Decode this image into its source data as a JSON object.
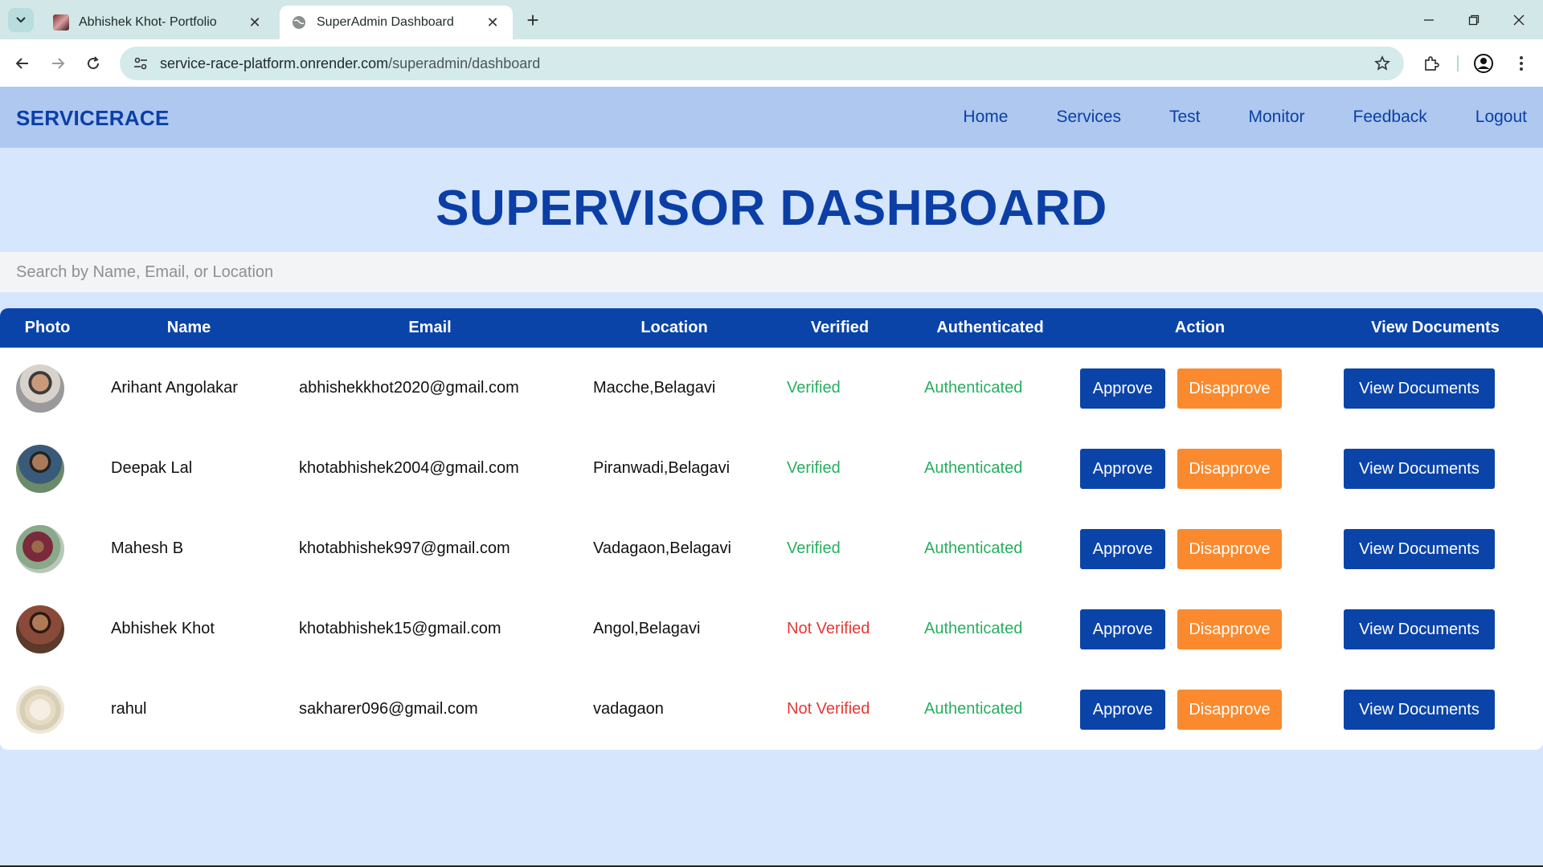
{
  "browser": {
    "tabs": [
      {
        "title": "Abhishek Khot- Portfolio",
        "active": false
      },
      {
        "title": "SuperAdmin Dashboard",
        "active": true
      }
    ],
    "url_host": "service-race-platform.onrender.com",
    "url_path": "/superadmin/dashboard"
  },
  "nav": {
    "brand": "SERVICERACE",
    "links": [
      "Home",
      "Services",
      "Test",
      "Monitor",
      "Feedback",
      "Logout"
    ]
  },
  "page": {
    "title": "SUPERVISOR DASHBOARD",
    "search_placeholder": "Search by Name, Email, or Location"
  },
  "table": {
    "headers": [
      "Photo",
      "Name",
      "Email",
      "Location",
      "Verified",
      "Authenticated",
      "Action",
      "View Documents"
    ],
    "buttons": {
      "approve": "Approve",
      "disapprove": "Disapprove",
      "view_documents": "View Documents"
    },
    "rows": [
      {
        "name": "Arihant Angolakar",
        "email": "abhishekkhot2020@gmail.com",
        "location": "Macche,Belagavi",
        "verified": "Verified",
        "authenticated": "Authenticated"
      },
      {
        "name": "Deepak Lal",
        "email": "khotabhishek2004@gmail.com",
        "location": "Piranwadi,Belagavi",
        "verified": "Verified",
        "authenticated": "Authenticated"
      },
      {
        "name": "Mahesh B",
        "email": "khotabhishek997@gmail.com",
        "location": "Vadagaon,Belagavi",
        "verified": "Verified",
        "authenticated": "Authenticated"
      },
      {
        "name": "Abhishek Khot",
        "email": "khotabhishek15@gmail.com",
        "location": "Angol,Belagavi",
        "verified": "Not Verified",
        "authenticated": "Authenticated"
      },
      {
        "name": "rahul",
        "email": "sakharer096@gmail.com",
        "location": "vadagaon",
        "verified": "Not Verified",
        "authenticated": "Authenticated"
      }
    ]
  },
  "colors": {
    "brand_blue": "#0b44a9",
    "nav_bg": "#aec8ef",
    "page_bg": "#d6e6fd",
    "verified_green": "#27ae60",
    "not_verified_red": "#e53935",
    "disapprove_orange": "#fb8a2e"
  }
}
